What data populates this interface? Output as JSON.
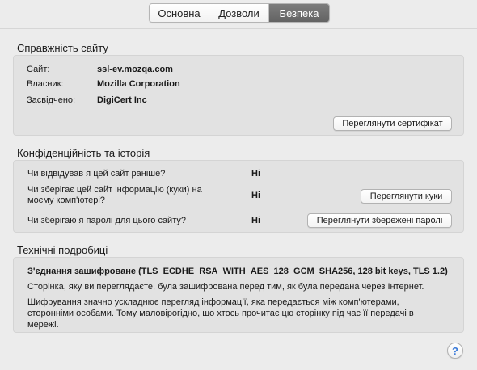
{
  "tabs": [
    {
      "label": "Основна",
      "active": false
    },
    {
      "label": "Дозволи",
      "active": false
    },
    {
      "label": "Безпека",
      "active": true
    }
  ],
  "identity": {
    "title": "Справжність сайту",
    "site_label": "Сайт:",
    "site_value": "ssl-ev.mozqa.com",
    "owner_label": "Власник:",
    "owner_value": "Mozilla Corporation",
    "verified_label": "Засвідчено:",
    "verified_value": "DigiCert Inc",
    "view_cert_button": "Переглянути сертифікат"
  },
  "privacy": {
    "title": "Конфіденційність та історія",
    "q1": "Чи відвідував я цей сайт раніше?",
    "a1": "Ні",
    "q2_line1": "Чи зберігає цей сайт інформацію (куки) на",
    "q2_line2": "моєму комп'ютері?",
    "a2": "Ні",
    "view_cookies_button": "Переглянути куки",
    "q3": "Чи зберігаю я паролі для цього сайту?",
    "a3": "Ні",
    "view_passwords_button": "Переглянути збережені паролі"
  },
  "technical": {
    "title": "Технічні подробиці",
    "heading": "З'єднання зашифроване (TLS_ECDHE_RSA_WITH_AES_128_GCM_SHA256, 128 bit keys, TLS 1.2)",
    "para1": "Сторінка, яку ви переглядаєте, була зашифрована перед тим, як була передана через Інтернет.",
    "para2_line1": "Шифрування значно ускладнює перегляд інформації, яка передається між комп'ютерами,",
    "para2_line2": "сторонніми особами. Тому маловірогідно, що хтось прочитає цю сторінку під час її передачі в",
    "para2_line3": "мережі."
  },
  "help": {
    "glyph": "?",
    "accent": "#3b7bd9"
  }
}
